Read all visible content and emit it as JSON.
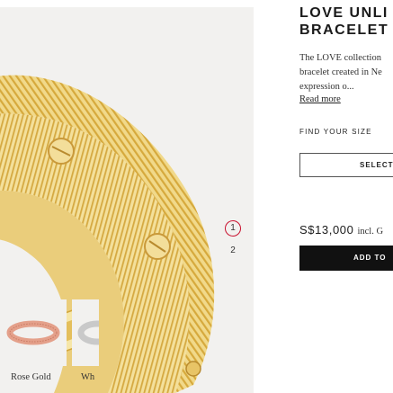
{
  "product": {
    "title_line1": "LOVE UNLI",
    "title_line2": "BRACELET",
    "description_lines": [
      "The LOVE collection",
      "bracelet created in Ne",
      "expression o..."
    ],
    "read_more": "Read more",
    "size_label": "FIND YOUR SIZE",
    "size_select": "SELECT",
    "price": "S$13,000",
    "tax_note": "incl. G",
    "add_button": "ADD TO"
  },
  "carousel": {
    "indicators": [
      "1",
      "2"
    ],
    "active_index": 0
  },
  "variants": [
    {
      "label": "Rose Gold"
    },
    {
      "label": "Wh"
    }
  ],
  "colors": {
    "accent": "#c8102e",
    "gold": "#e8c768",
    "rose_gold": "#e4a08a",
    "button": "#111111"
  }
}
